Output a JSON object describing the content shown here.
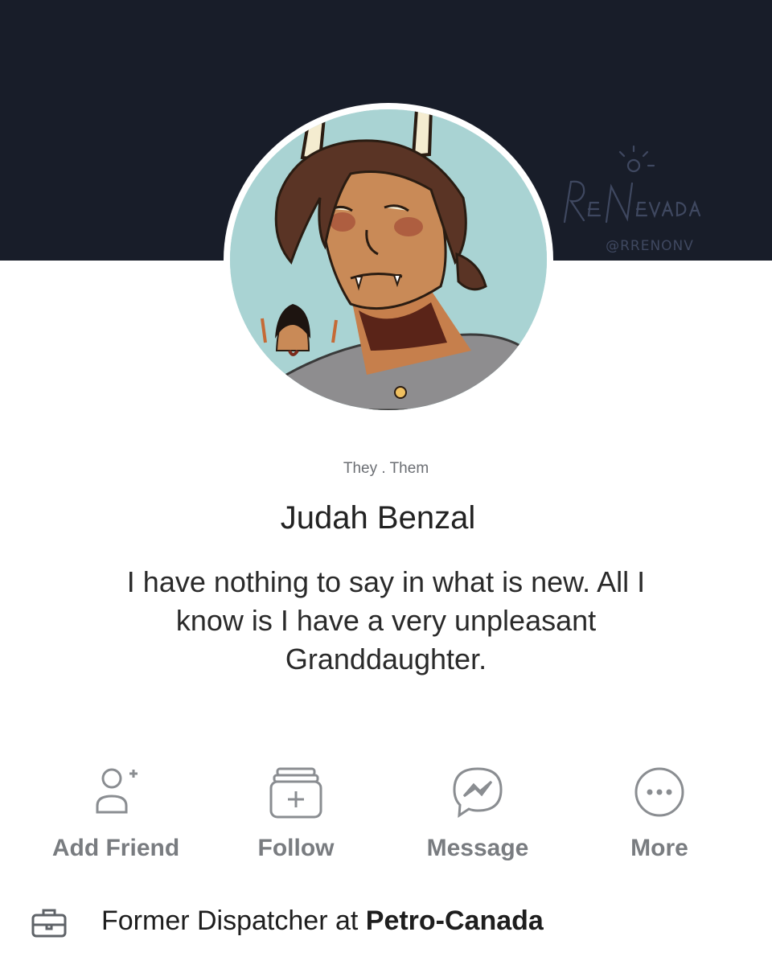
{
  "profile": {
    "pronouns": "They . Them",
    "name": "Judah Benzal",
    "bio_line1": "I have nothing to say in what is new. All I",
    "bio_line2": "know is I have a very unpleasant",
    "bio_line3": "Granddaughter."
  },
  "watermark": {
    "signature": "ReNevada",
    "handle": "@RRENONV"
  },
  "actions": [
    {
      "label": "Add Friend",
      "icon": "add-friend-icon"
    },
    {
      "label": "Follow",
      "icon": "follow-icon"
    },
    {
      "label": "Message",
      "icon": "messenger-icon"
    },
    {
      "label": "More",
      "icon": "more-icon"
    }
  ],
  "work": {
    "icon": "briefcase-icon",
    "prefix": "Former Dispatcher at ",
    "employer": "Petro-Canada"
  },
  "colors": {
    "cover": "#181d29",
    "avatar_bg": "#a9d3d3",
    "action_gray": "#797c80"
  }
}
